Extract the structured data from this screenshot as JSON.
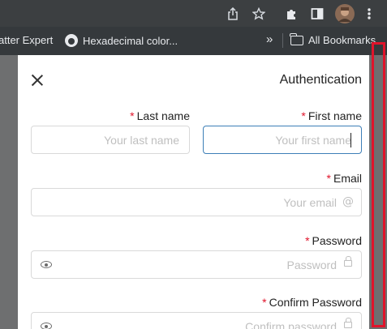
{
  "browser": {
    "toolbar_icons": [
      "share-icon",
      "star-icon",
      "extensions-icon",
      "sidepanel-icon",
      "avatar",
      "menu-icon"
    ],
    "bookmarks": {
      "items": [
        {
          "label": "atter Expert"
        },
        {
          "label": "Hexadecimal color..."
        }
      ],
      "overflow_label": "»",
      "all_bookmarks_label": "All Bookmarks"
    }
  },
  "drawer": {
    "title": "Authentication",
    "required_marker": "*",
    "fields": {
      "last_name": {
        "label": "Last name",
        "placeholder": "Your last name"
      },
      "first_name": {
        "label": "First name",
        "placeholder": "Your first name"
      },
      "email": {
        "label": "Email",
        "placeholder": "Your email",
        "icon": "at-icon"
      },
      "password": {
        "label": "Password",
        "placeholder": "Password",
        "icon": "lock-icon"
      },
      "confirm_password": {
        "label": "Confirm Password",
        "placeholder": "Confirm password",
        "icon": "lock-icon"
      }
    }
  },
  "colors": {
    "required": "#e0142b",
    "focus_border": "#3d7fb7",
    "highlight_frame": "#e0142b"
  }
}
